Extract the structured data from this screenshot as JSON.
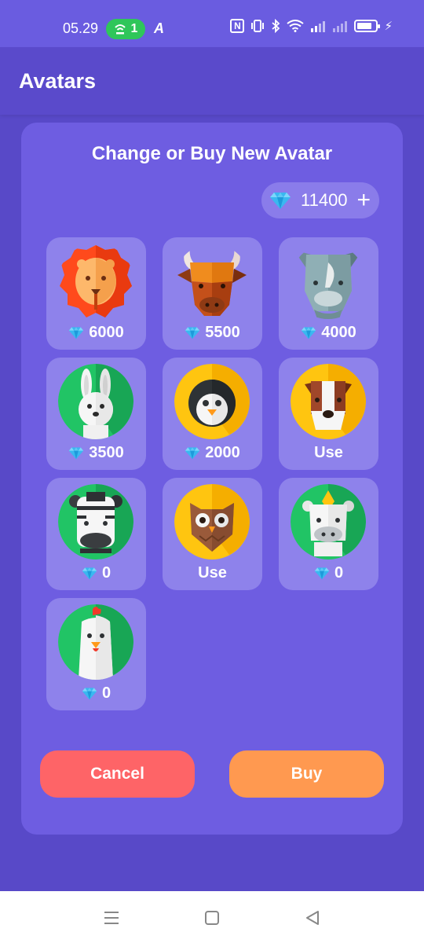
{
  "status_bar": {
    "time": "05.29",
    "hotspot_count": "1"
  },
  "app_bar": {
    "title": "Avatars"
  },
  "dialog": {
    "title": "Change or Buy New Avatar",
    "balance": "11400",
    "cancel_label": "Cancel",
    "buy_label": "Buy"
  },
  "avatars": [
    {
      "animal": "lion",
      "price": "6000"
    },
    {
      "animal": "bull",
      "price": "5500"
    },
    {
      "animal": "rhino",
      "price": "4000"
    },
    {
      "animal": "rabbit",
      "price": "3500"
    },
    {
      "animal": "penguin",
      "price": "2000"
    },
    {
      "animal": "dog",
      "action": "Use"
    },
    {
      "animal": "zebra",
      "price": "0"
    },
    {
      "animal": "owl",
      "action": "Use"
    },
    {
      "animal": "unicorn",
      "price": "0"
    },
    {
      "animal": "chicken",
      "price": "0"
    }
  ],
  "colors": {
    "background": "#5849C8",
    "dialog": "#6E5DE1",
    "card": "#8E82EB",
    "cancel": "#FE6467",
    "buy": "#FF9950",
    "hotspot": "#2FC65A"
  }
}
